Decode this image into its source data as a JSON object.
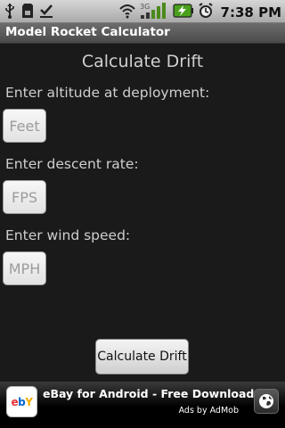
{
  "status_bar": {
    "time": "7:38 PM",
    "network": "3G",
    "icons": [
      "usb-icon",
      "sd-card-icon",
      "download-done-icon",
      "wifi-icon",
      "signal-icon",
      "battery-charging-icon",
      "alarm-icon"
    ]
  },
  "app": {
    "title": "Model Rocket Calculator"
  },
  "main": {
    "heading": "Calculate Drift",
    "fields": [
      {
        "label": "Enter altitude at deployment:",
        "placeholder": "Feet"
      },
      {
        "label": "Enter descent rate:",
        "placeholder": "FPS"
      },
      {
        "label": "Enter wind speed:",
        "placeholder": "MPH"
      }
    ],
    "button_label": "Calculate Drift"
  },
  "ad": {
    "text": "eBay for Android - Free Download",
    "subtext": "Ads by AdMob",
    "logo_text": "ebY",
    "colors": {
      "e": "#e53238",
      "b": "#0064d2",
      "Y": "#f5af02"
    }
  }
}
